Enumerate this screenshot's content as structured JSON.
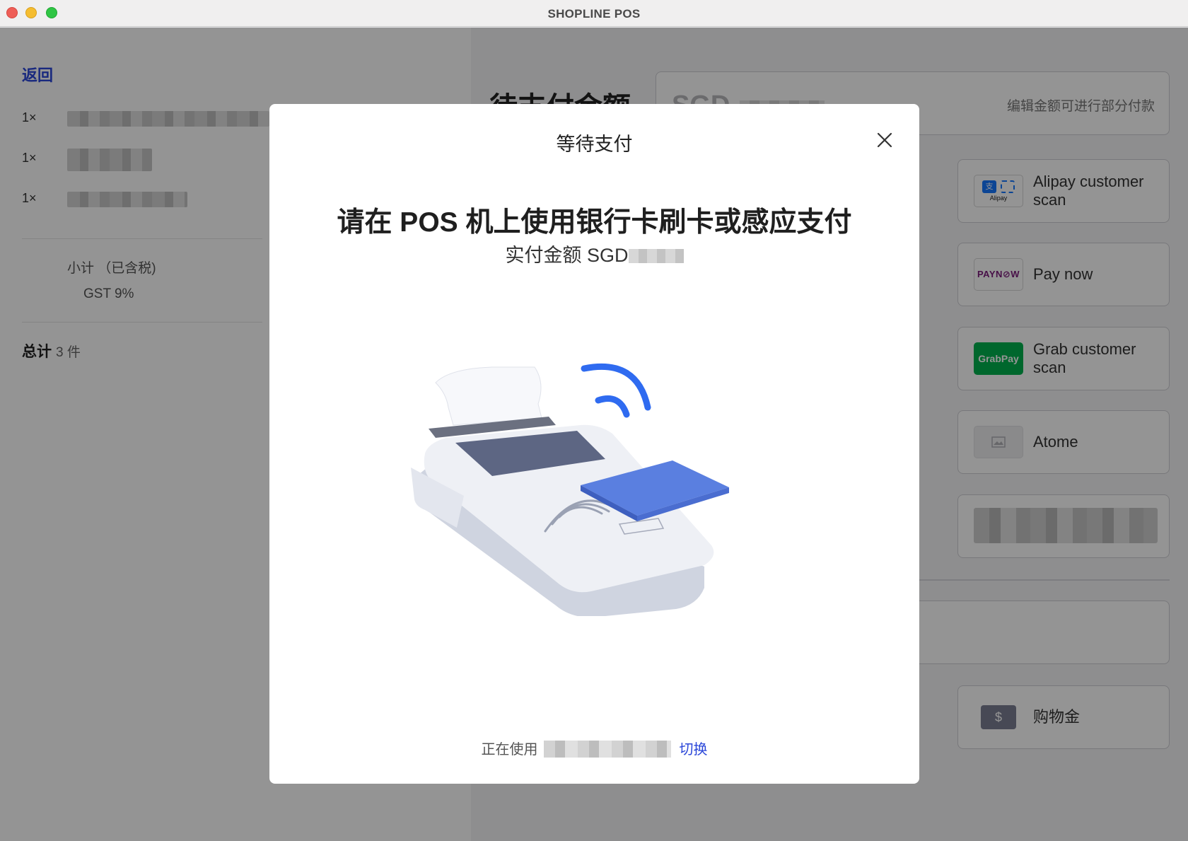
{
  "window": {
    "title": "SHOPLINE POS"
  },
  "cart": {
    "back_label": "返回",
    "items": [
      {
        "qty": "1×"
      },
      {
        "qty": "1×"
      },
      {
        "qty": "1×"
      }
    ],
    "subtotal_label": "小计 （已含税)",
    "gst_label": "GST 9%",
    "total_label": "总计",
    "total_count": "3 件"
  },
  "payment": {
    "pending_label": "待支付金额",
    "currency": "SGD",
    "edit_hint": "编辑金额可进行部分付款",
    "methods": [
      {
        "label": "Alipay customer scan",
        "icon": "alipay-icon"
      },
      {
        "label": "Pay now",
        "icon": "paynow-icon",
        "logo_text": "PAYN⊘W"
      },
      {
        "label": "Grab customer scan",
        "icon": "grabpay-icon",
        "logo_text": "GrabPay"
      },
      {
        "label": "Atome",
        "icon": "image-placeholder-icon"
      },
      {
        "label": "购物金",
        "icon": "voucher-icon"
      }
    ],
    "alipay_logo_text": "Alipay"
  },
  "modal": {
    "title": "等待支付",
    "heading": "请在 POS 机上使用银行卡刷卡或感应支付",
    "amount_label": "实付金额 SGD",
    "footer_using": "正在使用",
    "switch_label": "切换"
  },
  "colors": {
    "accent": "#2b47d9",
    "overlay": "rgba(0,0,0,0.42)",
    "nfc_blue": "#2f6bf0",
    "grab_green": "#00b14f"
  }
}
